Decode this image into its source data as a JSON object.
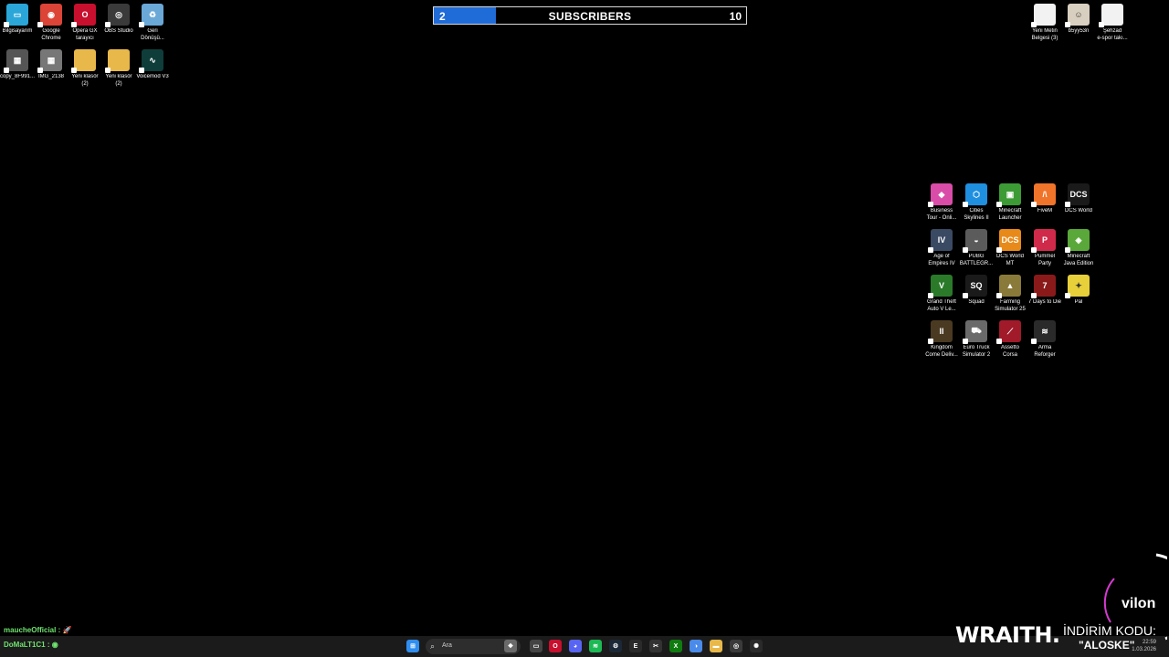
{
  "subscribers": {
    "current": "2",
    "title": "SUBSCRIBERS",
    "goal": "10",
    "progress": 0.2
  },
  "desktop_left": [
    {
      "label": "Bilgisayarım",
      "color": "#2aa7d8",
      "glyph": "▭",
      "icon": "computer-icon"
    },
    {
      "label": "Google\nChrome",
      "color": "#db4437",
      "glyph": "◉",
      "icon": "chrome-icon"
    },
    {
      "label": "Opera GX\ntarayıcı",
      "color": "#c8102e",
      "glyph": "O",
      "icon": "opera-gx-icon"
    },
    {
      "label": "OBS Studio",
      "color": "#3a3a3a",
      "glyph": "◎",
      "icon": "obs-icon"
    },
    {
      "label": "Geri\nDönüşü...",
      "color": "#6aa8d8",
      "glyph": "♻",
      "icon": "recycle-bin-icon"
    },
    {
      "label": "copy_8F991...",
      "color": "#555555",
      "glyph": "▦",
      "icon": "image-file-icon"
    },
    {
      "label": "IMG_2138",
      "color": "#777777",
      "glyph": "▦",
      "icon": "image-file-icon"
    },
    {
      "label": "Yeni klasör\n(2)",
      "color": "#e8b84a",
      "glyph": "",
      "icon": "folder-icon"
    },
    {
      "label": "Yeni klasör\n(2)",
      "color": "#e8b84a",
      "glyph": "",
      "icon": "folder-icon"
    },
    {
      "label": "Voicemod V3",
      "color": "#0f3d3a",
      "glyph": "∿",
      "icon": "voicemod-icon"
    }
  ],
  "desktop_right_top": [
    {
      "label": "Yeni Metin\nBelgesi (3)",
      "color": "#f2f2f2",
      "glyph": "",
      "icon": "text-document-icon"
    },
    {
      "label": "b5yy53n",
      "color": "#d9cfc0",
      "glyph": "☺",
      "icon": "user-image-icon"
    },
    {
      "label": "Şehzad\ne-spor takı...",
      "color": "#f2f2f2",
      "glyph": "",
      "icon": "document-icon"
    }
  ],
  "desktop_games": [
    {
      "label": "Business\nTour - Onli...",
      "color": "#d94ca8",
      "glyph": "◆",
      "icon": "business-tour-icon"
    },
    {
      "label": "Cities\nSkylines II",
      "color": "#1f8fe0",
      "glyph": "⬡",
      "icon": "cities-skylines-icon"
    },
    {
      "label": "Minecraft\nLauncher",
      "color": "#3d9b35",
      "glyph": "▣",
      "icon": "minecraft-launcher-icon"
    },
    {
      "label": "FiveM",
      "color": "#f0742a",
      "glyph": "/\\",
      "icon": "fivem-icon"
    },
    {
      "label": "DCS World",
      "color": "#1a1a1a",
      "glyph": "DCS",
      "icon": "dcs-world-icon"
    },
    {
      "label": "Age of\nEmpires IV",
      "color": "#3b4a63",
      "glyph": "IV",
      "icon": "age-of-empires-icon"
    },
    {
      "label": "PUBG\nBATTLEGR...",
      "color": "#5b5b5b",
      "glyph": "◒",
      "icon": "pubg-icon"
    },
    {
      "label": "DCS World\nMT",
      "color": "#e88a1a",
      "glyph": "DCS",
      "icon": "dcs-world-mt-icon"
    },
    {
      "label": "Pummel\nParty",
      "color": "#d02a4a",
      "glyph": "P",
      "icon": "pummel-party-icon"
    },
    {
      "label": "Minecraft\nJava Edition",
      "color": "#5aa83a",
      "glyph": "◈",
      "icon": "minecraft-java-icon"
    },
    {
      "label": "Grand Theft\nAuto V Le...",
      "color": "#2a7a2a",
      "glyph": "V",
      "icon": "gta-v-icon"
    },
    {
      "label": "Squad",
      "color": "#1a1a1a",
      "glyph": "SQ",
      "icon": "squad-icon"
    },
    {
      "label": "Farming\nSimulator 25",
      "color": "#8a7a3a",
      "glyph": "▲",
      "icon": "farming-simulator-icon"
    },
    {
      "label": "7 Days to Die",
      "color": "#8a1a1a",
      "glyph": "7",
      "icon": "seven-days-to-die-icon"
    },
    {
      "label": "Pal",
      "color": "#e8d03a",
      "glyph": "✦",
      "icon": "pal-icon"
    },
    {
      "label": "Kingdom\nCome Deliv...",
      "color": "#4a3a22",
      "glyph": "II",
      "icon": "kingdom-come-icon"
    },
    {
      "label": "Euro Truck\nSimulator 2",
      "color": "#6a6a6a",
      "glyph": "⛟",
      "icon": "euro-truck-icon"
    },
    {
      "label": "Assetto\nCorsa",
      "color": "#a01a2a",
      "glyph": "⟋",
      "icon": "assetto-corsa-icon"
    },
    {
      "label": "Arma\nReforger",
      "color": "#2a2a2a",
      "glyph": "≋",
      "icon": "arma-reforger-icon"
    }
  ],
  "chat": [
    {
      "user": "maucheOfficial :",
      "emoji": "🚀"
    },
    {
      "user": "DoMaLT1C1 :",
      "emoji": "◉"
    }
  ],
  "taskbar": {
    "search_placeholder": "Ara",
    "apps": [
      {
        "icon": "windows-start-icon",
        "color": "#2f8ef0",
        "glyph": "⊞"
      },
      {
        "icon": "widget-icon",
        "color": "#6a6a6a",
        "glyph": "❖"
      },
      {
        "icon": "task-view-icon",
        "color": "#444444",
        "glyph": "▭"
      },
      {
        "icon": "opera-gx-icon",
        "color": "#c8102e",
        "glyph": "O"
      },
      {
        "icon": "discord-icon",
        "color": "#5865f2",
        "glyph": "◕"
      },
      {
        "icon": "spotify-icon",
        "color": "#1db954",
        "glyph": "≋"
      },
      {
        "icon": "steam-icon",
        "color": "#1b2838",
        "glyph": "⚙"
      },
      {
        "icon": "epic-games-icon",
        "color": "#2a2a2a",
        "glyph": "E"
      },
      {
        "icon": "capcut-icon",
        "color": "#333333",
        "glyph": "✂"
      },
      {
        "icon": "xbox-icon",
        "color": "#107c10",
        "glyph": "X"
      },
      {
        "icon": "copilot-icon",
        "color": "#4a8ae8",
        "glyph": "◑"
      },
      {
        "icon": "file-explorer-icon",
        "color": "#e8b84a",
        "glyph": "▬"
      },
      {
        "icon": "obs-icon",
        "color": "#3a3a3a",
        "glyph": "◎"
      },
      {
        "icon": "steelseries-icon",
        "color": "#2a2a2a",
        "glyph": "✺"
      }
    ],
    "clock_time": "22:59",
    "clock_date": "1.03.2026"
  },
  "sponsor": {
    "brand": "WRAITH.",
    "code_label": "İNDİRİM KODU:",
    "code": "\"ALOSKE\"",
    "ring_text": "vilon"
  }
}
